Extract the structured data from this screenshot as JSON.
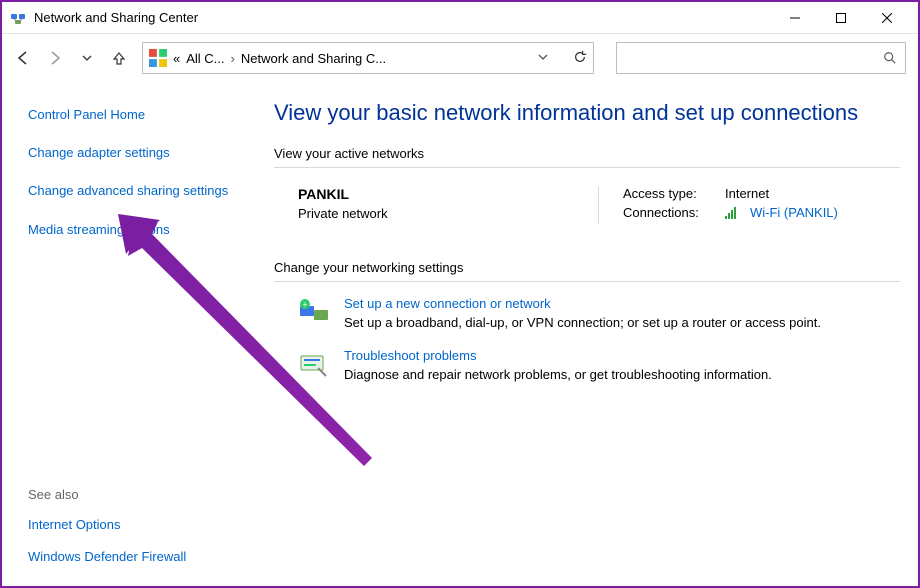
{
  "window": {
    "title": "Network and Sharing Center"
  },
  "address": {
    "seg1": "All C...",
    "seg2": "Network and Sharing C..."
  },
  "sidebar": {
    "home": "Control Panel Home",
    "adapter": "Change adapter settings",
    "advanced": "Change advanced sharing settings",
    "media": "Media streaming options"
  },
  "see_also": {
    "header": "See also",
    "internet": "Internet Options",
    "firewall": "Windows Defender Firewall"
  },
  "main": {
    "heading": "View your basic network information and set up connections",
    "active_label": "View your active networks",
    "network": {
      "name": "PANKIL",
      "type": "Private network",
      "access_label": "Access type:",
      "access_value": "Internet",
      "conn_label": "Connections:",
      "conn_value": "Wi-Fi (PANKIL)"
    },
    "change_label": "Change your networking settings",
    "opt1": {
      "title": "Set up a new connection or network",
      "desc": "Set up a broadband, dial-up, or VPN connection; or set up a router or access point."
    },
    "opt2": {
      "title": "Troubleshoot problems",
      "desc": "Diagnose and repair network problems, or get troubleshooting information."
    }
  }
}
